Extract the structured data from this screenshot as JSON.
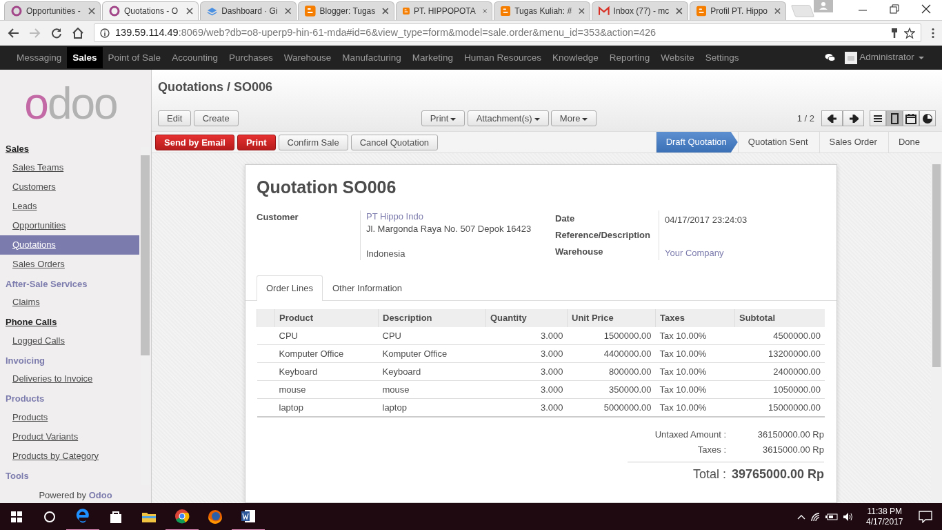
{
  "browser": {
    "tabs": [
      {
        "title": "Opportunities -",
        "kind": "odoo",
        "selected": false
      },
      {
        "title": "Quotations - O",
        "kind": "odoo",
        "selected": true
      },
      {
        "title": "Dashboard · Gi",
        "kind": "stack",
        "selected": false
      },
      {
        "title": "Blogger: Tugas",
        "kind": "blogger",
        "selected": false
      },
      {
        "title": "PT. HIPPOPOTA",
        "kind": "blogger",
        "selected": false
      },
      {
        "title": "Tugas Kuliah: #",
        "kind": "blogger",
        "selected": false
      },
      {
        "title": "Inbox (77) - mc",
        "kind": "mail",
        "selected": false
      },
      {
        "title": "Profil PT. Hippo",
        "kind": "blogger",
        "selected": false
      }
    ],
    "url_host": "139.59.114.49",
    "url_rest": ":8069/web?db=o8-uperp9-hin-61-mda#id=6&view_type=form&model=sale.order&menu_id=353&action=426"
  },
  "navbar": {
    "menus": [
      {
        "label": "Messaging",
        "selected": false
      },
      {
        "label": "Sales",
        "selected": true
      },
      {
        "label": "Point of Sale",
        "selected": false
      },
      {
        "label": "Accounting",
        "selected": false
      },
      {
        "label": "Purchases",
        "selected": false
      },
      {
        "label": "Warehouse",
        "selected": false
      },
      {
        "label": "Manufacturing",
        "selected": false
      },
      {
        "label": "Marketing",
        "selected": false
      },
      {
        "label": "Human Resources",
        "selected": false
      },
      {
        "label": "Knowledge",
        "selected": false
      },
      {
        "label": "Reporting",
        "selected": false
      },
      {
        "label": "Website",
        "selected": false
      },
      {
        "label": "Settings",
        "selected": false
      }
    ],
    "user": "Administrator"
  },
  "sidebar": {
    "logo": "odoo",
    "sections": [
      {
        "title": "Sales",
        "kind": "link",
        "items": [
          {
            "label": "Sales Teams",
            "selected": false
          },
          {
            "label": "Customers",
            "selected": false
          },
          {
            "label": "Leads",
            "selected": false
          },
          {
            "label": "Opportunities",
            "selected": false
          },
          {
            "label": "Quotations",
            "selected": true
          },
          {
            "label": "Sales Orders",
            "selected": false
          }
        ]
      },
      {
        "title": "After-Sale Services",
        "kind": "heading",
        "items": [
          {
            "label": "Claims",
            "selected": false
          }
        ]
      },
      {
        "title": "Phone Calls",
        "kind": "link",
        "items": [
          {
            "label": "Logged Calls",
            "selected": false
          }
        ]
      },
      {
        "title": "Invoicing",
        "kind": "heading",
        "items": [
          {
            "label": "Deliveries to Invoice",
            "selected": false
          }
        ]
      },
      {
        "title": "Products",
        "kind": "heading",
        "items": [
          {
            "label": "Products",
            "selected": false
          },
          {
            "label": "Product Variants",
            "selected": false
          },
          {
            "label": "Products by Category",
            "selected": false
          }
        ]
      },
      {
        "title": "Tools",
        "kind": "heading"
      }
    ],
    "powered_by": "Powered by",
    "brand": "Odoo"
  },
  "breadcrumb": {
    "parent": "Quotations",
    "separator": "/",
    "current": "SO006"
  },
  "toolbar": {
    "left_buttons": [
      "Edit",
      "Create"
    ],
    "dropdowns": [
      "Print",
      "Attachment(s)",
      "More"
    ],
    "pager": "1 / 2",
    "views": [
      {
        "kind": "list",
        "selected": false
      },
      {
        "kind": "form",
        "selected": true
      },
      {
        "kind": "calendar",
        "selected": false
      },
      {
        "kind": "graph",
        "selected": false
      }
    ]
  },
  "statusbar": {
    "buttons": [
      {
        "label": "Send by Email",
        "kind": "primary"
      },
      {
        "label": "Print",
        "kind": "primary"
      },
      {
        "label": "Confirm Sale",
        "kind": "default"
      },
      {
        "label": "Cancel Quotation",
        "kind": "default"
      }
    ],
    "stages": [
      {
        "label": "Draft Quotation",
        "selected": true
      },
      {
        "label": "Quotation Sent",
        "selected": false
      },
      {
        "label": "Sales Order",
        "selected": false
      },
      {
        "label": "Done",
        "selected": false
      }
    ]
  },
  "sheet": {
    "title": "Quotation",
    "number": "SO006",
    "customer": {
      "label": "Customer",
      "name": "PT Hippo Indo",
      "street": "Jl. Margonda Raya No. 507 Depok 16423",
      "country": "Indonesia"
    },
    "right_fields": [
      {
        "label": "Date",
        "value": "04/17/2017 23:24:03",
        "kind": "text"
      },
      {
        "label": "Reference/Description",
        "kind": "empty"
      },
      {
        "label": "Warehouse",
        "value": "Your Company",
        "kind": "link"
      }
    ],
    "tabs": [
      {
        "label": "Order Lines",
        "selected": true
      },
      {
        "label": "Other Information",
        "selected": false
      }
    ],
    "table": {
      "columns": [
        "Product",
        "Description",
        "Quantity",
        "Unit Price",
        "Taxes",
        "Subtotal"
      ],
      "rows": [
        [
          "CPU",
          "CPU",
          "3.000",
          "1500000.00",
          "Tax 10.00%",
          "4500000.00"
        ],
        [
          "Komputer Office",
          "Komputer Office",
          "3.000",
          "4400000.00",
          "Tax 10.00%",
          "13200000.00"
        ],
        [
          "Keyboard",
          "Keyboard",
          "3.000",
          "800000.00",
          "Tax 10.00%",
          "2400000.00"
        ],
        [
          "mouse",
          "mouse",
          "3.000",
          "350000.00",
          "Tax 10.00%",
          "1050000.00"
        ],
        [
          "laptop",
          "laptop",
          "3.000",
          "5000000.00",
          "Tax 10.00%",
          "15000000.00"
        ]
      ]
    },
    "totals": [
      {
        "label": "Untaxed Amount :",
        "value": "36150000.00 Rp"
      },
      {
        "label": "Taxes :",
        "value": "3615000.00 Rp"
      }
    ],
    "total": {
      "label": "Total :",
      "value": "39765000.00 Rp"
    }
  },
  "taskbar": {
    "apps": [
      {
        "kind": "edge",
        "running": true
      },
      {
        "kind": "store",
        "running": false
      },
      {
        "kind": "explorer",
        "running": false
      },
      {
        "kind": "chrome",
        "running": true
      },
      {
        "kind": "firefox",
        "running": false
      },
      {
        "kind": "word",
        "running": true
      }
    ],
    "time": "11:38 PM",
    "date": "4/17/2017"
  }
}
